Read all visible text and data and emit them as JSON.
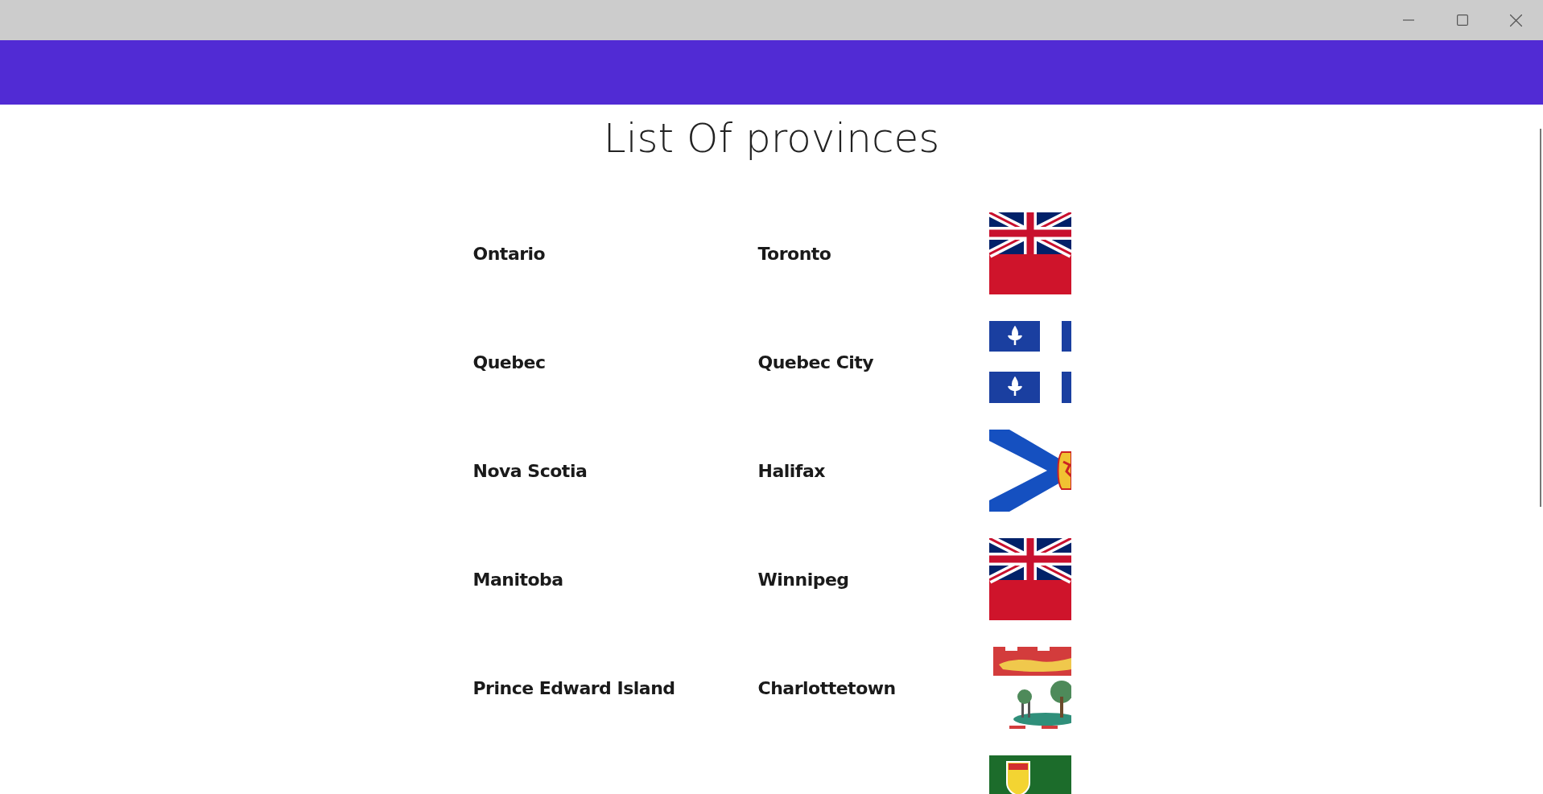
{
  "window": {
    "controls": [
      {
        "kind": "minimize"
      },
      {
        "kind": "maximize"
      },
      {
        "kind": "close"
      }
    ]
  },
  "page": {
    "title": "List Of provinces"
  },
  "provinces": [
    {
      "name": "Ontario",
      "capital": "Toronto",
      "kind": "ensign"
    },
    {
      "name": "Quebec",
      "capital": "Quebec City",
      "kind": "quebec"
    },
    {
      "name": "Nova Scotia",
      "capital": "Halifax",
      "kind": "novascotia"
    },
    {
      "name": "Manitoba",
      "capital": "Winnipeg",
      "kind": "ensign"
    },
    {
      "name": "Prince Edward Island",
      "capital": "Charlottetown",
      "kind": "pei"
    },
    {
      "kind": "saskatchewan"
    }
  ]
}
